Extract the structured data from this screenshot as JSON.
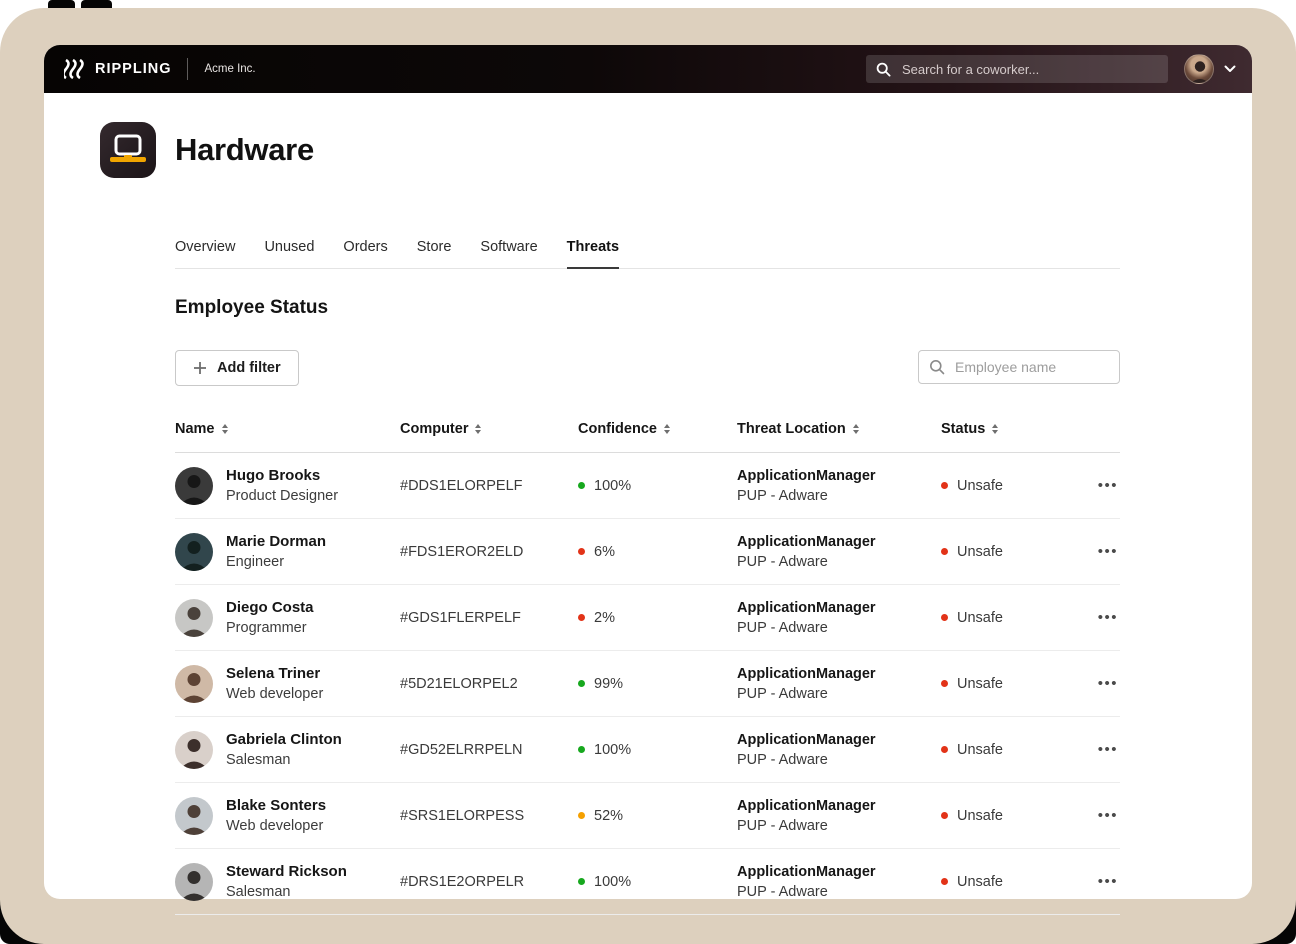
{
  "frame": {
    "matte_color": "#050505",
    "frame_color": "#ddd0be"
  },
  "topbar": {
    "brand": "RIPPLING",
    "company": "Acme Inc.",
    "search_placeholder": "Search for a coworker...",
    "brand_mark_icon": "rippling-waves-icon",
    "avatar": "user-photo",
    "chevron_icon": "chevron-down-icon"
  },
  "page": {
    "title": "Hardware",
    "app_icon": "laptop-icon",
    "app_icon_accent": "#f0a500"
  },
  "tabs": {
    "items": [
      {
        "label": "Overview"
      },
      {
        "label": "Unused"
      },
      {
        "label": "Orders"
      },
      {
        "label": "Store"
      },
      {
        "label": "Software"
      },
      {
        "label": "Threats"
      }
    ],
    "active": "Threats"
  },
  "section": {
    "title": "Employee Status",
    "add_filter_label": "Add filter",
    "employee_search_placeholder": "Employee name"
  },
  "table": {
    "headers": [
      "Name",
      "Computer",
      "Confidence",
      "Threat Location",
      "Status"
    ],
    "dot_colors": {
      "green": "#17a81e",
      "red": "#e23318",
      "orange": "#f5a000"
    },
    "menu_icon": "ellipsis-icon",
    "menu_glyph": "•••",
    "rows": [
      {
        "name": "Hugo Brooks",
        "role": "Product Designer",
        "computer": "#DDS1ELORPELF",
        "confidence": "100%",
        "confidence_level": "green",
        "threat_app": "ApplicationManager",
        "threat_type": "PUP - Adware",
        "status": "Unsafe",
        "status_level": "red",
        "avatar_bg": "#3a3a3a",
        "avatar_fg": "#171717"
      },
      {
        "name": "Marie Dorman",
        "role": "Engineer",
        "computer": "#FDS1EROR2ELD",
        "confidence": "6%",
        "confidence_level": "red",
        "threat_app": "ApplicationManager",
        "threat_type": "PUP - Adware",
        "status": "Unsafe",
        "status_level": "red",
        "avatar_bg": "#31464c",
        "avatar_fg": "#13201f"
      },
      {
        "name": "Diego Costa",
        "role": "Programmer",
        "computer": "#GDS1FLERPELF",
        "confidence": "2%",
        "confidence_level": "red",
        "threat_app": "ApplicationManager",
        "threat_type": "PUP - Adware",
        "status": "Unsafe",
        "status_level": "red",
        "avatar_bg": "#c7c7c5",
        "avatar_fg": "#4a423c"
      },
      {
        "name": "Selena Triner",
        "role": "Web developer",
        "computer": "#5D21ELORPEL2",
        "confidence": "99%",
        "confidence_level": "green",
        "threat_app": "ApplicationManager",
        "threat_type": "PUP - Adware",
        "status": "Unsafe",
        "status_level": "red",
        "avatar_bg": "#cfb9a6",
        "avatar_fg": "#5d4334"
      },
      {
        "name": "Gabriela Clinton",
        "role": "Salesman",
        "computer": "#GD52ELRRPELN",
        "confidence": "100%",
        "confidence_level": "green",
        "threat_app": "ApplicationManager",
        "threat_type": "PUP - Adware",
        "status": "Unsafe",
        "status_level": "red",
        "avatar_bg": "#d9d0ca",
        "avatar_fg": "#3c2f2b"
      },
      {
        "name": "Blake Sonters",
        "role": "Web developer",
        "computer": "#SRS1ELORPESS",
        "confidence": "52%",
        "confidence_level": "orange",
        "threat_app": "ApplicationManager",
        "threat_type": "PUP - Adware",
        "status": "Unsafe",
        "status_level": "red",
        "avatar_bg": "#c3c8cc",
        "avatar_fg": "#4e4038"
      },
      {
        "name": "Steward Rickson",
        "role": "Salesman",
        "computer": "#DRS1E2ORPELR",
        "confidence": "100%",
        "confidence_level": "green",
        "threat_app": "ApplicationManager",
        "threat_type": "PUP - Adware",
        "status": "Unsafe",
        "status_level": "red",
        "avatar_bg": "#b5b5b5",
        "avatar_fg": "#33302e"
      }
    ]
  }
}
